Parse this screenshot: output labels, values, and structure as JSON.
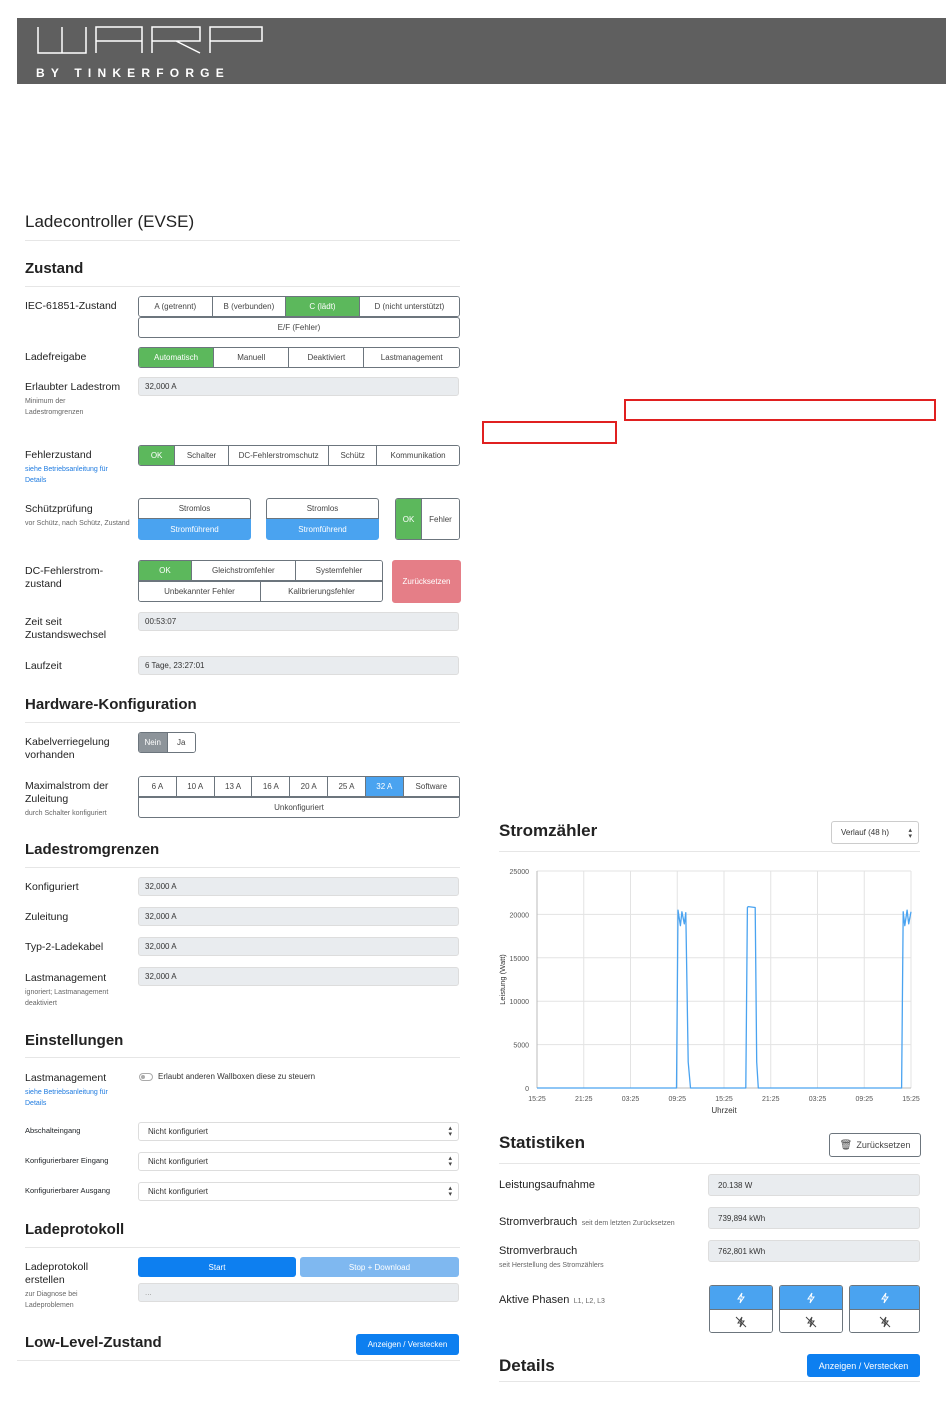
{
  "header": {
    "logo_wordmark": "WARP",
    "logo_subtitle": "BY TINKERFORGE"
  },
  "evse": {
    "title": "Ladecontroller (EVSE)",
    "zustand": {
      "title": "Zustand",
      "iec_label": "IEC-61851-Zustand",
      "iec_states": [
        "A (getrennt)",
        "B (verbunden)",
        "C (lädt)",
        "D (nicht unterstützt)"
      ],
      "iec_ef": "E/F (Fehler)",
      "ladefreigabe_label": "Ladefreigabe",
      "ladefreigabe_options": [
        "Automatisch",
        "Manuell",
        "Deaktiviert",
        "Lastmanagement"
      ],
      "erlaubt_label": "Erlaubter Ladestrom",
      "erlaubt_sub": "Minimum der Ladestromgrenzen",
      "erlaubt_value": "32,000 A",
      "fehler_label": "Fehlerzustand",
      "fehler_sub": "siehe Betriebsanleitung für Details",
      "fehler_options": [
        "OK",
        "Schalter",
        "DC-Fehlerstromschutz",
        "Schütz",
        "Kommunikation"
      ],
      "schuetz_label": "Schützprüfung",
      "schuetz_sub": "vor Schütz, nach Schütz, Zustand",
      "schuetz_a": [
        "Stromlos",
        "Stromführend"
      ],
      "schuetz_b": [
        "Stromlos",
        "Stromführend"
      ],
      "schuetz_c": [
        "OK",
        "Fehler"
      ],
      "dc_label": "DC-Fehlerstrom-zustand",
      "dc_row1": [
        "OK",
        "Gleichstromfehler",
        "Systemfehler"
      ],
      "dc_row2": [
        "Unbekannter Fehler",
        "Kalibrierungsfehler"
      ],
      "dc_reset": "Zurücksetzen",
      "zeit_label": "Zeit seit Zustandswechsel",
      "zeit_value": "00:53:07",
      "laufzeit_label": "Laufzeit",
      "laufzeit_value": "6 Tage, 23:27:01"
    },
    "hardware": {
      "title": "Hardware-Konfiguration",
      "kabel_label": "Kabelverriegelung vorhanden",
      "kabel_options": [
        "Nein",
        "Ja"
      ],
      "max_label": "Maximalstrom der Zuleitung",
      "max_sub": "durch Schalter konfiguriert",
      "max_options": [
        "6 A",
        "10 A",
        "13 A",
        "16 A",
        "20 A",
        "25 A",
        "32 A",
        "Software"
      ],
      "max_unconf": "Unkonfiguriert"
    },
    "grenzen": {
      "title": "Ladestromgrenzen",
      "konf_label": "Konfiguriert",
      "konf_value": "32,000 A",
      "zul_label": "Zuleitung",
      "zul_value": "32,000 A",
      "typ2_label": "Typ-2-Ladekabel",
      "typ2_value": "32,000 A",
      "last_label": "Lastmanagement",
      "last_sub": "ignoriert; Lastmanagement deaktiviert",
      "last_value": "32,000 A"
    },
    "einstellungen": {
      "title": "Einstellungen",
      "last_label": "Lastmanagement",
      "last_sub": "siehe Betriebsanleitung für Details",
      "last_toggle_text": "Erlaubt anderen Wallboxen diese zu steuern",
      "abschalt_label": "Abschalteingang",
      "abschalt_value": "Nicht konfiguriert",
      "keingang_label": "Konfigurierbarer Eingang",
      "keingang_value": "Nicht konfiguriert",
      "kausgang_label": "Konfigurierbarer Ausgang",
      "kausgang_value": "Nicht konfiguriert"
    },
    "protokoll": {
      "title": "Ladeprotokoll",
      "label": "Ladeprotokoll erstellen",
      "sub": "zur Diagnose bei Ladeproblemen",
      "start": "Start",
      "stop": "Stop + Download",
      "output": "..."
    },
    "lowlevel": {
      "title": "Low-Level-Zustand",
      "button": "Anzeigen / Verstecken"
    }
  },
  "meter": {
    "title": "Stromzähler",
    "history_select": "Verlauf (48 h)",
    "stats_title": "Statistiken",
    "stats_reset": "Zurücksetzen",
    "leistung_label": "Leistungsaufnahme",
    "leistung_value": "20.138 W",
    "verbrauch1_label": "Stromverbrauch",
    "verbrauch1_sub": "seit dem letzten Zurücksetzen",
    "verbrauch1_value": "739,894 kWh",
    "verbrauch2_label": "Stromverbrauch",
    "verbrauch2_sub": "seit Herstellung des Stromzählers",
    "verbrauch2_value": "762,801 kWh",
    "phasen_label": "Aktive Phasen",
    "phasen_sub": "L1, L2, L3",
    "details_title": "Details",
    "details_button": "Anzeigen / Verstecken"
  },
  "chart_data": {
    "type": "line",
    "title": "",
    "xlabel": "Uhrzeit",
    "ylabel": "Leistung (Watt)",
    "ylim": [
      0,
      25000
    ],
    "yticks": [
      "0",
      "5000",
      "10000",
      "15000",
      "20000",
      "25000"
    ],
    "xticks": [
      "15:25",
      "21:25",
      "03:25",
      "09:25",
      "15:25",
      "21:25",
      "03:25",
      "09:25",
      "15:25"
    ],
    "grid": true,
    "color": "#4aa3f0",
    "series": [
      {
        "x_hours": [
          0,
          17.9,
          18.1,
          18.4,
          18.6,
          18.9,
          19.1,
          19.4,
          19.7,
          20.0,
          20.2,
          20.5,
          26.8,
          27.0,
          27.1,
          28.0,
          28.2,
          28.4,
          28.6,
          46.8,
          47.0,
          47.2,
          47.5,
          47.7,
          48.0
        ],
        "values": [
          0,
          0,
          20500,
          18700,
          20300,
          18900,
          20200,
          3000,
          0,
          0,
          0,
          0,
          0,
          20800,
          20900,
          20800,
          3000,
          0,
          0,
          0,
          20300,
          18700,
          20500,
          18900,
          20300
        ]
      }
    ]
  }
}
